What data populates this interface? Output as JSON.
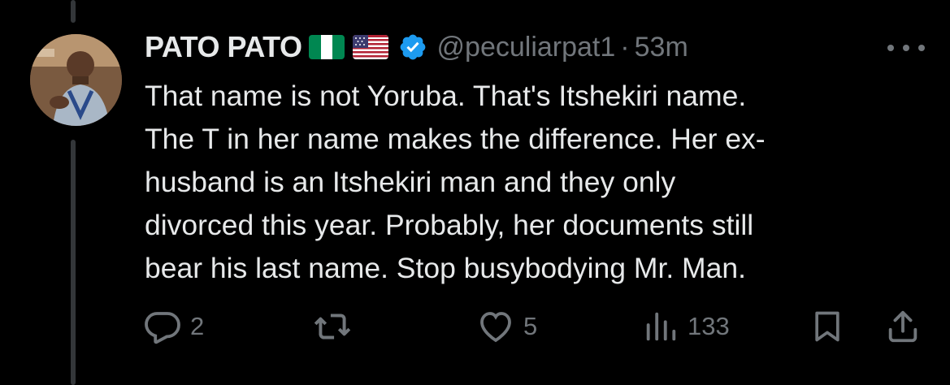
{
  "tweet": {
    "author": {
      "display_name": "PATO PATO",
      "flags": [
        "nigeria-flag-icon",
        "usa-flag-icon"
      ],
      "verified": true,
      "handle": "@peculiarpat1",
      "time_ago": "53m"
    },
    "text": "That name is not Yoruba. That's Itshekiri name.\nThe T in her name makes the difference. Her ex-\nhusband is an Itshekiri man and they only\ndivorced this year. Probably, her documents still\nbear his last name. Stop busybodying Mr. Man.",
    "actions": {
      "replies": "2",
      "reposts": "",
      "likes": "5",
      "views": "133"
    }
  },
  "colors": {
    "background": "#000000",
    "text": "#e7e9ea",
    "secondary": "#71767b",
    "verified": "#1d9bf0",
    "thread_line": "#333639"
  }
}
